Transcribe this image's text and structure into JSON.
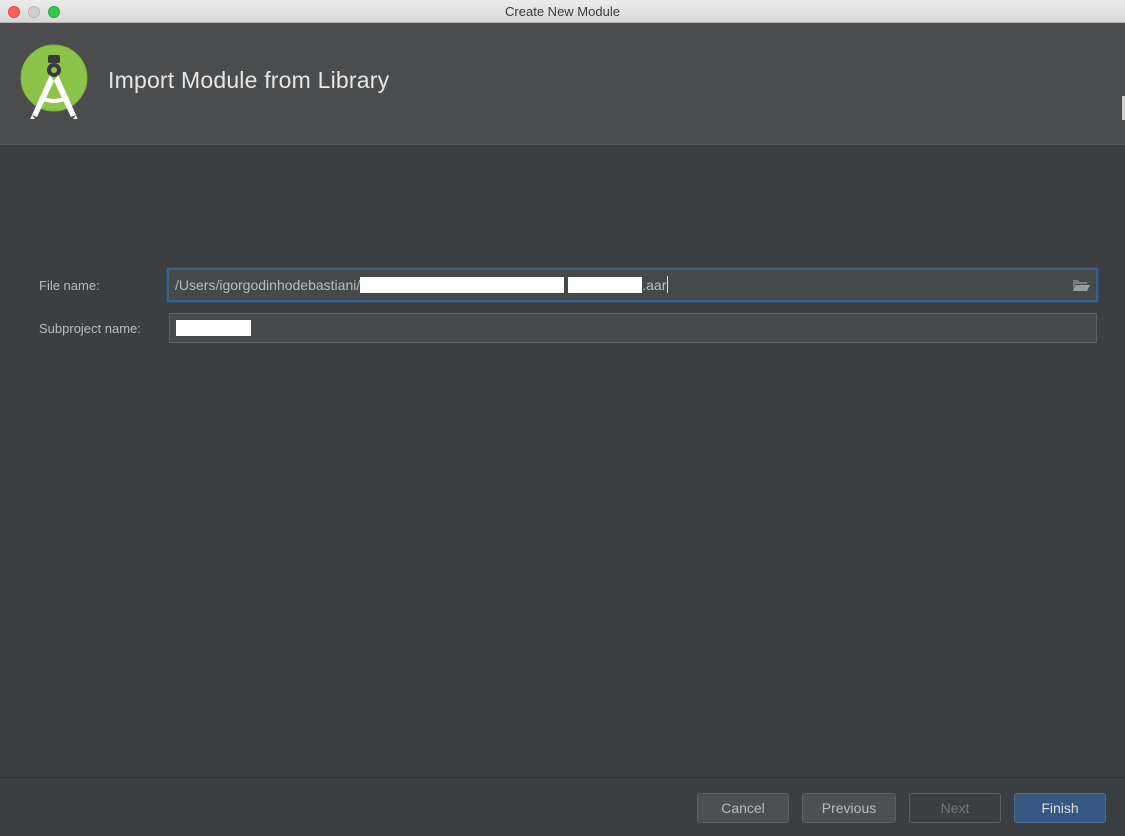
{
  "window": {
    "title": "Create New Module"
  },
  "header": {
    "title": "Import Module from Library",
    "logo_icon": "android-studio-logo",
    "accent_color": "#8cc34a"
  },
  "form": {
    "file_name_label": "File name:",
    "file_name_prefix": "/Users/igorgodinhodebastiani/",
    "file_name_suffix": ".aar",
    "folder_icon": "folder-open-icon",
    "subproject_label": "Subproject name:"
  },
  "footer": {
    "cancel_label": "Cancel",
    "previous_label": "Previous",
    "next_label": "Next",
    "finish_label": "Finish"
  }
}
